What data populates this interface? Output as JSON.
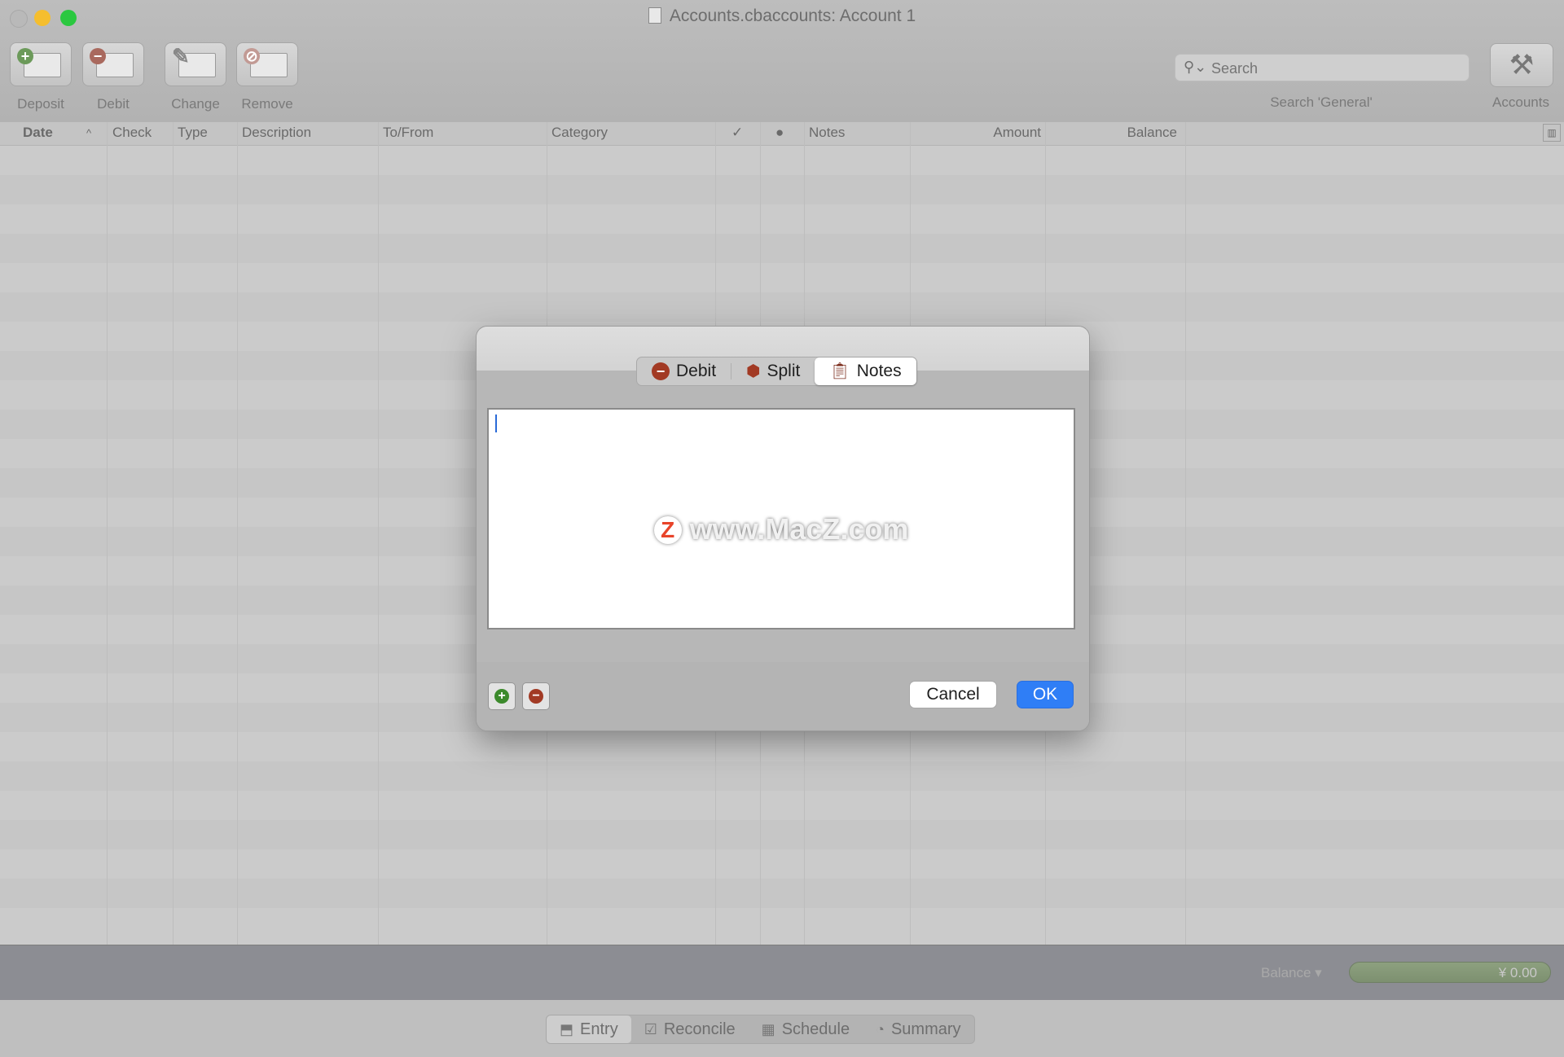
{
  "window": {
    "title": "Accounts.cbaccounts:  Account 1"
  },
  "toolbar": {
    "deposit_label": "Deposit",
    "debit_label": "Debit",
    "change_label": "Change",
    "remove_label": "Remove",
    "search_placeholder": "Search",
    "search_caption": "Search 'General'",
    "accounts_label": "Accounts"
  },
  "table": {
    "columns": [
      "Date",
      "Check",
      "Type",
      "Description",
      "To/From",
      "Category",
      "✓",
      "●",
      "Notes",
      "Amount",
      "Balance"
    ]
  },
  "dialog": {
    "tabs": [
      {
        "label": "Debit",
        "icon": "minus-circle-icon"
      },
      {
        "label": "Split",
        "icon": "cube-icon"
      },
      {
        "label": "Notes",
        "icon": "clipboard-icon",
        "selected": true
      }
    ],
    "notes_value": "",
    "watermark": "www.MacZ.com",
    "cancel_label": "Cancel",
    "ok_label": "OK"
  },
  "status": {
    "balance_label": "Balance ▾",
    "balance_value": "¥ 0.00"
  },
  "bottom_tabs": [
    {
      "label": "Entry",
      "selected": true
    },
    {
      "label": "Reconcile"
    },
    {
      "label": "Schedule"
    },
    {
      "label": "Summary"
    }
  ],
  "colors": {
    "accent": "#2f7ef6",
    "debit_red": "#a23a24",
    "add_green": "#3c8a2c"
  }
}
